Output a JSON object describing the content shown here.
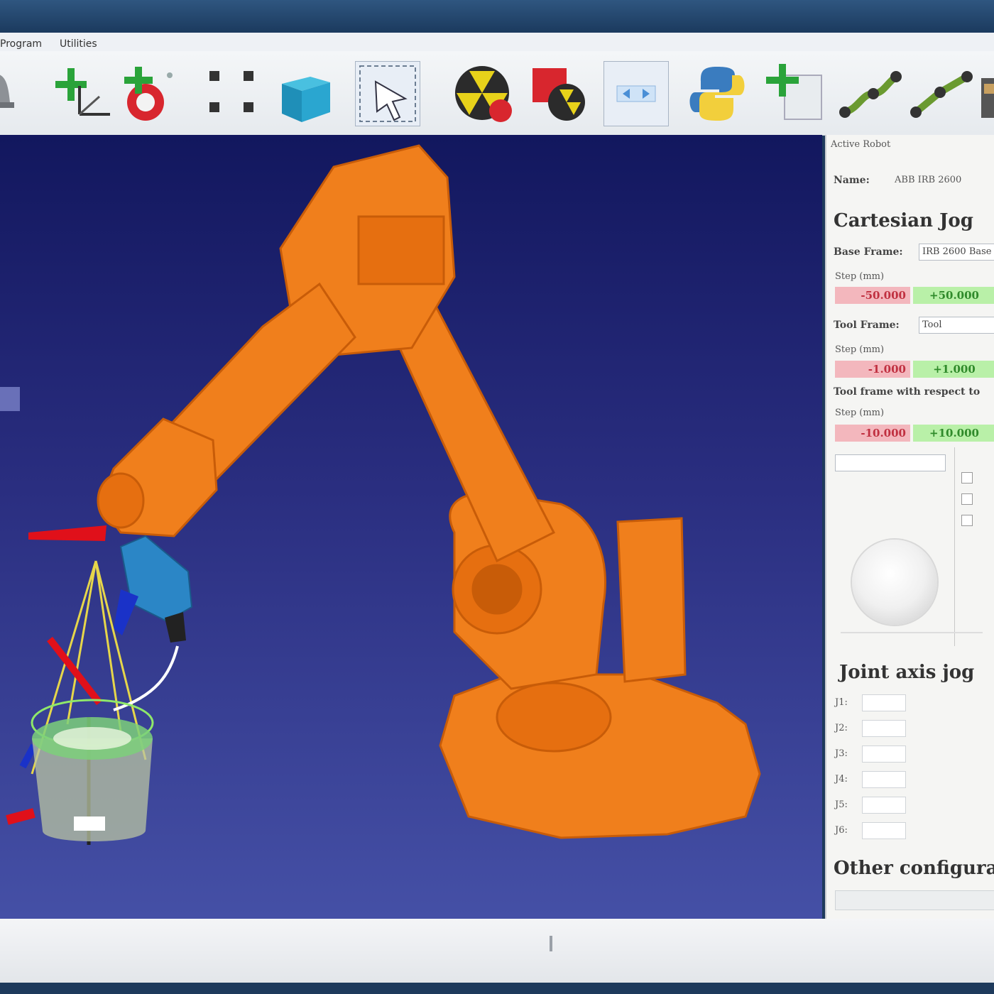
{
  "menubar": {
    "items": [
      "Program",
      "Utilities"
    ]
  },
  "toolbar": {
    "buttons": [
      "add-target-icon",
      "add-frame-icon",
      "add-tool-icon",
      "grid-points-icon",
      "cube-object-icon",
      "selection-icon",
      "collision-icon",
      "robot-program-icon",
      "view-fit-icon",
      "python-script-icon",
      "add-item-icon",
      "move-linear-icon",
      "move-joint-icon"
    ]
  },
  "panel": {
    "title": "Active Robot",
    "name_label": "Name:",
    "name_value": "ABB IRB 2600",
    "cartesian_heading": "Cartesian Jog",
    "base_frame_label": "Base Frame:",
    "base_frame_value": "IRB 2600 Base",
    "tool_frame_label": "Tool Frame:",
    "tool_frame_value": "Tool",
    "tool_frame_wrt_label": "Tool frame with respect to",
    "step_label": "Step (mm)",
    "neg_values": [
      "-50.000",
      "-1.000",
      "-10.000"
    ],
    "pos_values": [
      "+50.000",
      "+1.000",
      "+10.000"
    ],
    "joint_heading": "Joint axis jog",
    "joints": [
      "J1:",
      "J2:",
      "J3:",
      "J4:",
      "J5:",
      "J6:"
    ],
    "other_heading": "Other configurations"
  },
  "colors": {
    "robot": "#f07f1c",
    "viewport_top": "#12175e",
    "viewport_bottom": "#4550a6",
    "neg_bg": "#f3b7bd",
    "pos_bg": "#b9f0a8"
  }
}
